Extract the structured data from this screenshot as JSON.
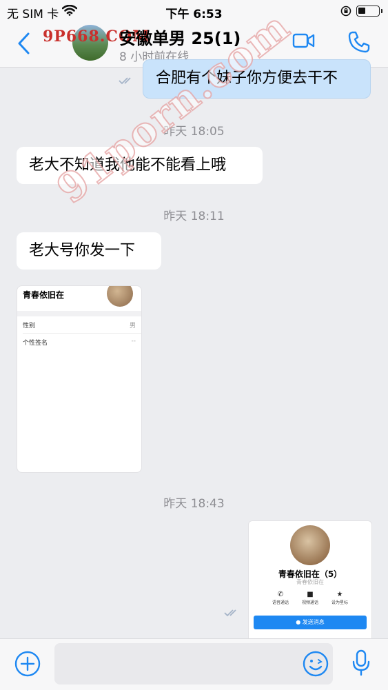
{
  "status_bar": {
    "carrier": "无 SIM 卡",
    "time": "下午 6:53"
  },
  "header": {
    "title": "安徽单男 25(1)",
    "subtitle": "8 小时前在线",
    "watermark": "9P668.COM"
  },
  "messages": [
    {
      "type": "text",
      "direction": "out",
      "text": "合肥有个妹子你方便去干不"
    },
    {
      "type": "time",
      "text": "昨天 18:05"
    },
    {
      "type": "text",
      "direction": "in",
      "text": "老大不知道我他能不能看上哦"
    },
    {
      "type": "time",
      "text": "昨天 18:11"
    },
    {
      "type": "text",
      "direction": "in",
      "text": "老大号你发一下"
    },
    {
      "type": "card",
      "direction": "in",
      "name": "青春依旧在",
      "rows": [
        {
          "label": "性别",
          "value": "男"
        },
        {
          "label": "个性签名",
          "value": "--"
        }
      ]
    },
    {
      "type": "time",
      "text": "昨天 18:43"
    },
    {
      "type": "card",
      "direction": "out",
      "name": "青春依旧在（5）",
      "sub": "青春依旧在",
      "actions": [
        {
          "icon": "phone-icon",
          "label": "语音通话"
        },
        {
          "icon": "video-icon",
          "label": "视频通话"
        },
        {
          "icon": "star-icon",
          "label": "设为星标"
        }
      ],
      "button": "发送消息"
    }
  ],
  "watermark_diagonal": "91porn.com",
  "colors": {
    "accent": "#1e88f2",
    "out_bubble": "#c9e3fb",
    "background": "#ecedf0"
  }
}
